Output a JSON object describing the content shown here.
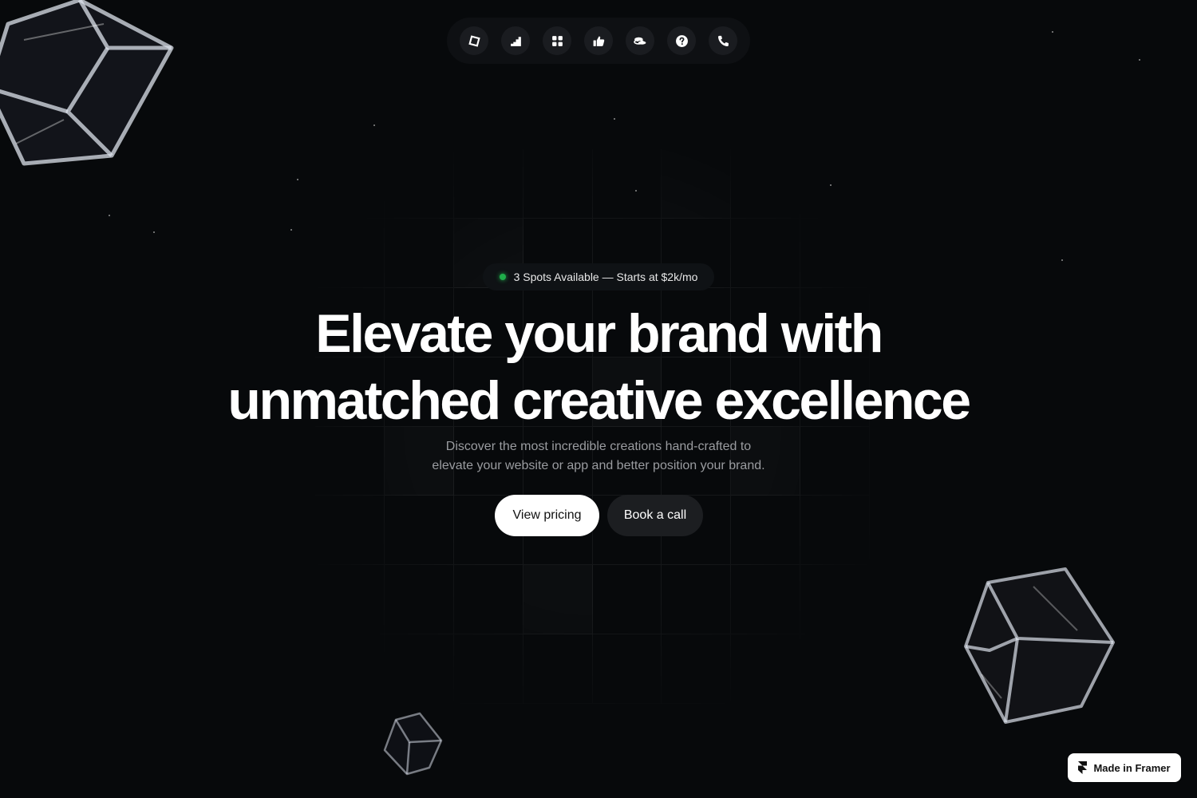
{
  "nav": {
    "items": [
      {
        "icon": "diamond-frame-icon"
      },
      {
        "icon": "steps-chart-icon"
      },
      {
        "icon": "grid-icon"
      },
      {
        "icon": "thumbs-up-icon"
      },
      {
        "icon": "coins-icon"
      },
      {
        "icon": "help-circle-icon"
      },
      {
        "icon": "phone-icon"
      }
    ]
  },
  "hero": {
    "badge": "3 Spots Available — Starts at $2k/mo",
    "badge_dot_color": "#1fae4a",
    "headline_line1": "Elevate your brand with",
    "headline_line2": "unmatched creative excellence",
    "subtitle_line1": "Discover the most incredible creations hand-crafted to",
    "subtitle_line2": "elevate your website or app and better position your brand.",
    "primary_cta": "View pricing",
    "secondary_cta": "Book a call"
  },
  "framer_badge": {
    "label": "Made in Framer",
    "icon": "framer-logo-icon"
  },
  "colors": {
    "background": "#07090b",
    "primary_button": "#ffffff",
    "secondary_button": "#1c1e21"
  }
}
